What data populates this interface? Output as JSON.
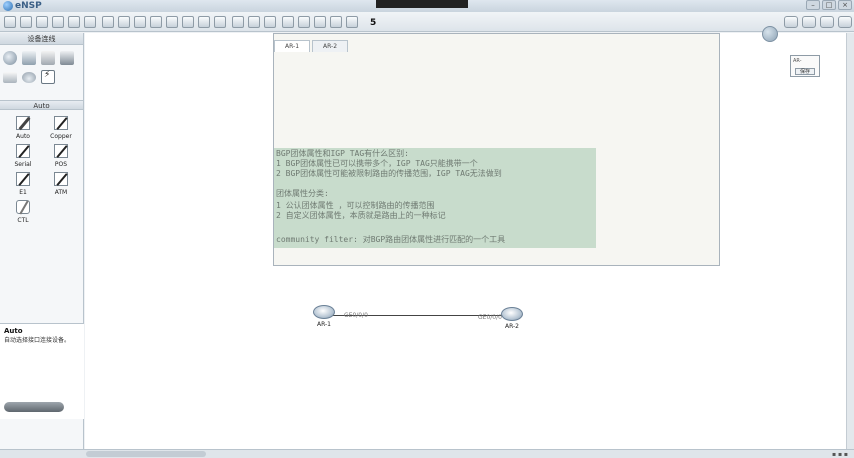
{
  "app": {
    "title": "eNSP"
  },
  "toolbar": {
    "marker": "5"
  },
  "left_panel": {
    "devices_header": "设备连线",
    "devices": [
      "router",
      "switch",
      "wlan",
      "firewall",
      "pc",
      "cloud",
      "connector"
    ],
    "cables_header": "Auto",
    "cables": [
      {
        "label": "Auto",
        "icon": "auto"
      },
      {
        "label": "Copper",
        "icon": "copper"
      },
      {
        "label": "Serial",
        "icon": "serial"
      },
      {
        "label": "POS",
        "icon": "pos"
      },
      {
        "label": "E1",
        "icon": "e1"
      },
      {
        "label": "ATM",
        "icon": "atm"
      },
      {
        "label": "CTL",
        "icon": "ctl"
      }
    ],
    "desc_title": "Auto",
    "desc_text": "自动选择接口连接设备。"
  },
  "note_window": {
    "tabs": [
      "AR-1",
      "AR-2"
    ],
    "lines": [
      "BGP团体属性和IGP TAG有什么区别:",
      " 1  BGP团体属性已可以携带多个，IGP TAG只能携带一个",
      " 2  BGP团体属性可能被限制路由的传播范围，IGP TAG无法做到",
      "",
      "团体属性分类:",
      " 1  公认团体属性 ，可以控制路由的传播范围",
      " 2  自定义团体属性，本质就是路由上的一种标记",
      "",
      "community filter: 对BGP路由团体属性进行匹配的一个工具"
    ]
  },
  "topology": {
    "nodes": [
      {
        "label": "AR-1"
      },
      {
        "label": "AR-2"
      }
    ],
    "ports": [
      "GE0/0/0",
      "GE0/0/0"
    ]
  },
  "widget": {
    "text": "AR-",
    "button": "保存"
  }
}
